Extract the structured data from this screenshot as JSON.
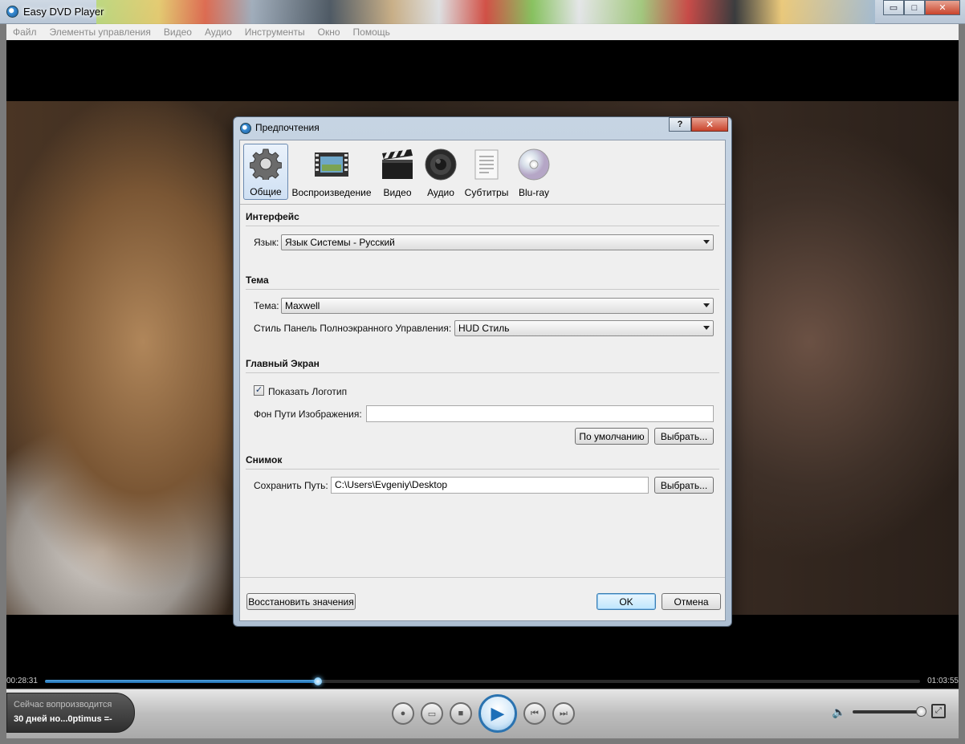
{
  "window": {
    "title": "Easy DVD Player",
    "buttons": {
      "minimize": "▭",
      "maximize": "□",
      "close": "✕"
    }
  },
  "menu": [
    "Файл",
    "Элементы управления",
    "Видео",
    "Аудио",
    "Инструменты",
    "Окно",
    "Помощь"
  ],
  "player": {
    "time_elapsed": "00:28:31",
    "time_total": "01:03:55",
    "progress": 0.312,
    "volume": 0.98,
    "now_playing_label": "Сейчас вопроизводится",
    "now_playing_title": "30 дней но...0ptimus =-"
  },
  "dialog": {
    "title": "Предпочтения",
    "help_label": "?",
    "close_label": "✕",
    "tabs": [
      {
        "label": "Общие",
        "icon": "gear-icon",
        "active": true
      },
      {
        "label": "Воспроизведение",
        "icon": "film-strip-icon",
        "active": false
      },
      {
        "label": "Видео",
        "icon": "clapperboard-icon",
        "active": false
      },
      {
        "label": "Аудио",
        "icon": "speaker-icon",
        "active": false
      },
      {
        "label": "Субтитры",
        "icon": "document-icon",
        "active": false
      },
      {
        "label": "Blu-ray",
        "icon": "disc-icon",
        "active": false
      }
    ],
    "interface": {
      "title": "Интерфейс",
      "language_label": "Язык:",
      "language_value": "Язык Системы - Русский"
    },
    "theme": {
      "title": "Тема",
      "theme_label": "Тема:",
      "theme_value": "Maxwell",
      "style_label": "Стиль Панель Полноэкранного Управления:",
      "style_value": "HUD Стиль"
    },
    "main_screen": {
      "title": "Главный Экран",
      "show_logo_label": "Показать Логотип",
      "show_logo_checked": "✓",
      "bg_path_label": "Фон Пути Изображения:",
      "bg_path_value": "",
      "default_button": "По умолчанию",
      "browse_button": "Выбрать..."
    },
    "snapshot": {
      "title": "Снимок",
      "save_path_label": "Сохранить Путь:",
      "save_path_value": "C:\\Users\\Evgeniy\\Desktop",
      "browse_button": "Выбрать..."
    },
    "restore_button": "Восстановить значения",
    "ok_button": "OK",
    "cancel_button": "Отмена"
  },
  "colors": {
    "accent": "#2b73b0",
    "progress": "#1f6fb0",
    "close_red": "#c9432a"
  }
}
